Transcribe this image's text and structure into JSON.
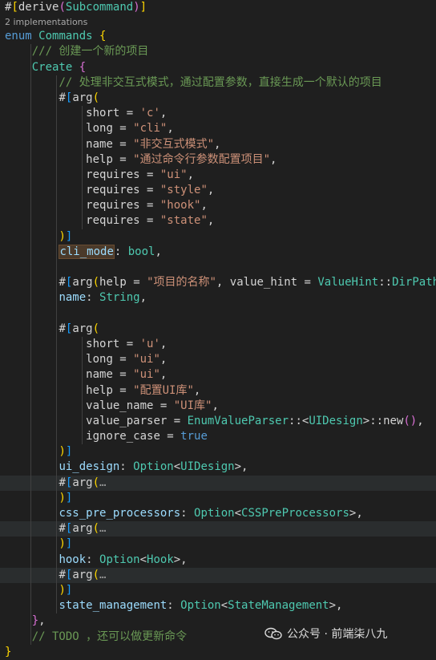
{
  "code": {
    "derive_attr": "#[derive(Subcommand)]",
    "codelens": "2 implementations",
    "enum_kw": "enum",
    "enum_name": "Commands",
    "doc_comment": "/// 创建一个新的项目",
    "variant": "Create",
    "comment_cli": "// 处理非交互式模式，通过配置参数，直接生成一个默认的项目",
    "arg1": {
      "short_val": "'c'",
      "long_val": "\"cli\"",
      "name_val": "\"非交互式模式\"",
      "help_val": "\"通过命令行参数配置项目\"",
      "req1": "\"ui\"",
      "req2": "\"style\"",
      "req3": "\"hook\"",
      "req4": "\"state\""
    },
    "cli_mode_field": "cli_mode",
    "cli_mode_type": "bool",
    "name_attr_help": "\"项目的名称\"",
    "name_attr_hint_type": "ValueHint",
    "name_attr_hint_val": "DirPath",
    "name_field": "name",
    "name_type": "String",
    "arg2": {
      "short_val": "'u'",
      "long_val": "\"ui\"",
      "name_val": "\"ui\"",
      "help_val": "\"配置UI库\"",
      "value_name_val": "\"UI库\"",
      "parser_type": "EnumValueParser",
      "parser_generic": "UIDesign",
      "parser_fn": "new",
      "ignore_case_val": "true"
    },
    "ui_design_field": "ui_design",
    "option_type": "Option",
    "ui_design_type": "UIDesign",
    "folded_marker": "…",
    "css_field": "css_pre_processors",
    "css_type": "CSSPreProcessors",
    "hook_field": "hook",
    "hook_type": "Hook",
    "state_field": "state_management",
    "state_type": "StateManagement",
    "todo_comment": "// TODO ，还可以做更新命令"
  },
  "watermark": {
    "text": "公众号 · 前端柒八九"
  }
}
